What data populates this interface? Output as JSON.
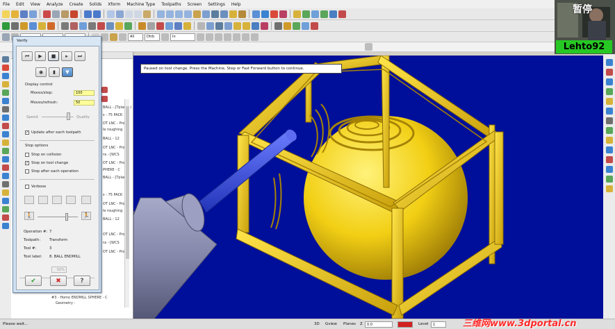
{
  "menu": [
    "File",
    "Edit",
    "View",
    "Analyze",
    "Create",
    "Solids",
    "Xform",
    "Machine Type",
    "Toolpaths",
    "Screen",
    "Settings",
    "Help"
  ],
  "toolbar": {
    "combo_all": "All",
    "combo_defn": "Dtrb",
    "combo_in": "In"
  },
  "viewport": {
    "message": "Paused on tool change.  Press the Machine, Step or Fast Forward button to continue.",
    "background": "#000f9a",
    "part_color": "#f4d318",
    "tool_color": "#3448d8"
  },
  "toolpanel": {
    "lines": [
      "BALL - [Tplane: (",
      "s - 75 PACK",
      "OT LNC - Progr",
      "le roughing",
      "BALL - 12",
      "OT LNC - Progr",
      "ra - [WCS",
      "OT LNC - Progr",
      "PHERE - C",
      "BALL - [Tplane",
      "s - 75 PACK",
      "OT LNC - Progr",
      "le roughing",
      "BALL - 12",
      "OT LNC - Progr",
      "ra - [WCS",
      "OT LNC - Progr"
    ],
    "bottom_items": [
      "#3 - Homo ENDMILL SPHERE - C",
      "Geometry -"
    ]
  },
  "verify": {
    "title": "Verify",
    "display_control": "Display control",
    "moves_step_label": "Moves/step:",
    "moves_step_value": "100",
    "moves_refresh_label": "Moves/refresh:",
    "moves_refresh_value": "50",
    "speed_label": "Speed",
    "quality_label": "Quality",
    "update_after": "Update after each toolpath",
    "stop_options": "Stop options",
    "stop_collision": "Stop on collision",
    "stop_tool_change": "Stop on tool change",
    "stop_each_op": "Stop after each operation",
    "verbose": "Verbose",
    "op_label": "Operation #:",
    "op_value": "7",
    "toolpath_label": "Toolpath:",
    "toolpath_value": "Transform",
    "tool_label": "Tool #:",
    "tool_value": "3",
    "tool_name_label": "Tool label:",
    "tool_name_value": "8. BALL ENDMILL",
    "gray_value": "50%",
    "checks": {
      "update_after": true,
      "stop_collision": false,
      "stop_tool_change": true,
      "stop_each_op": false,
      "verbose": false
    }
  },
  "status": {
    "left": "Please wait...",
    "mode": "3D",
    "gview": "Gview",
    "planes": "Planes",
    "z_label": "Z",
    "z_value": "0.0",
    "level_label": "Level",
    "level_value": "1"
  },
  "webcam": {
    "name": "Lehto92",
    "pause": "暂停"
  },
  "watermark": "三维网www.3dportal.cn"
}
